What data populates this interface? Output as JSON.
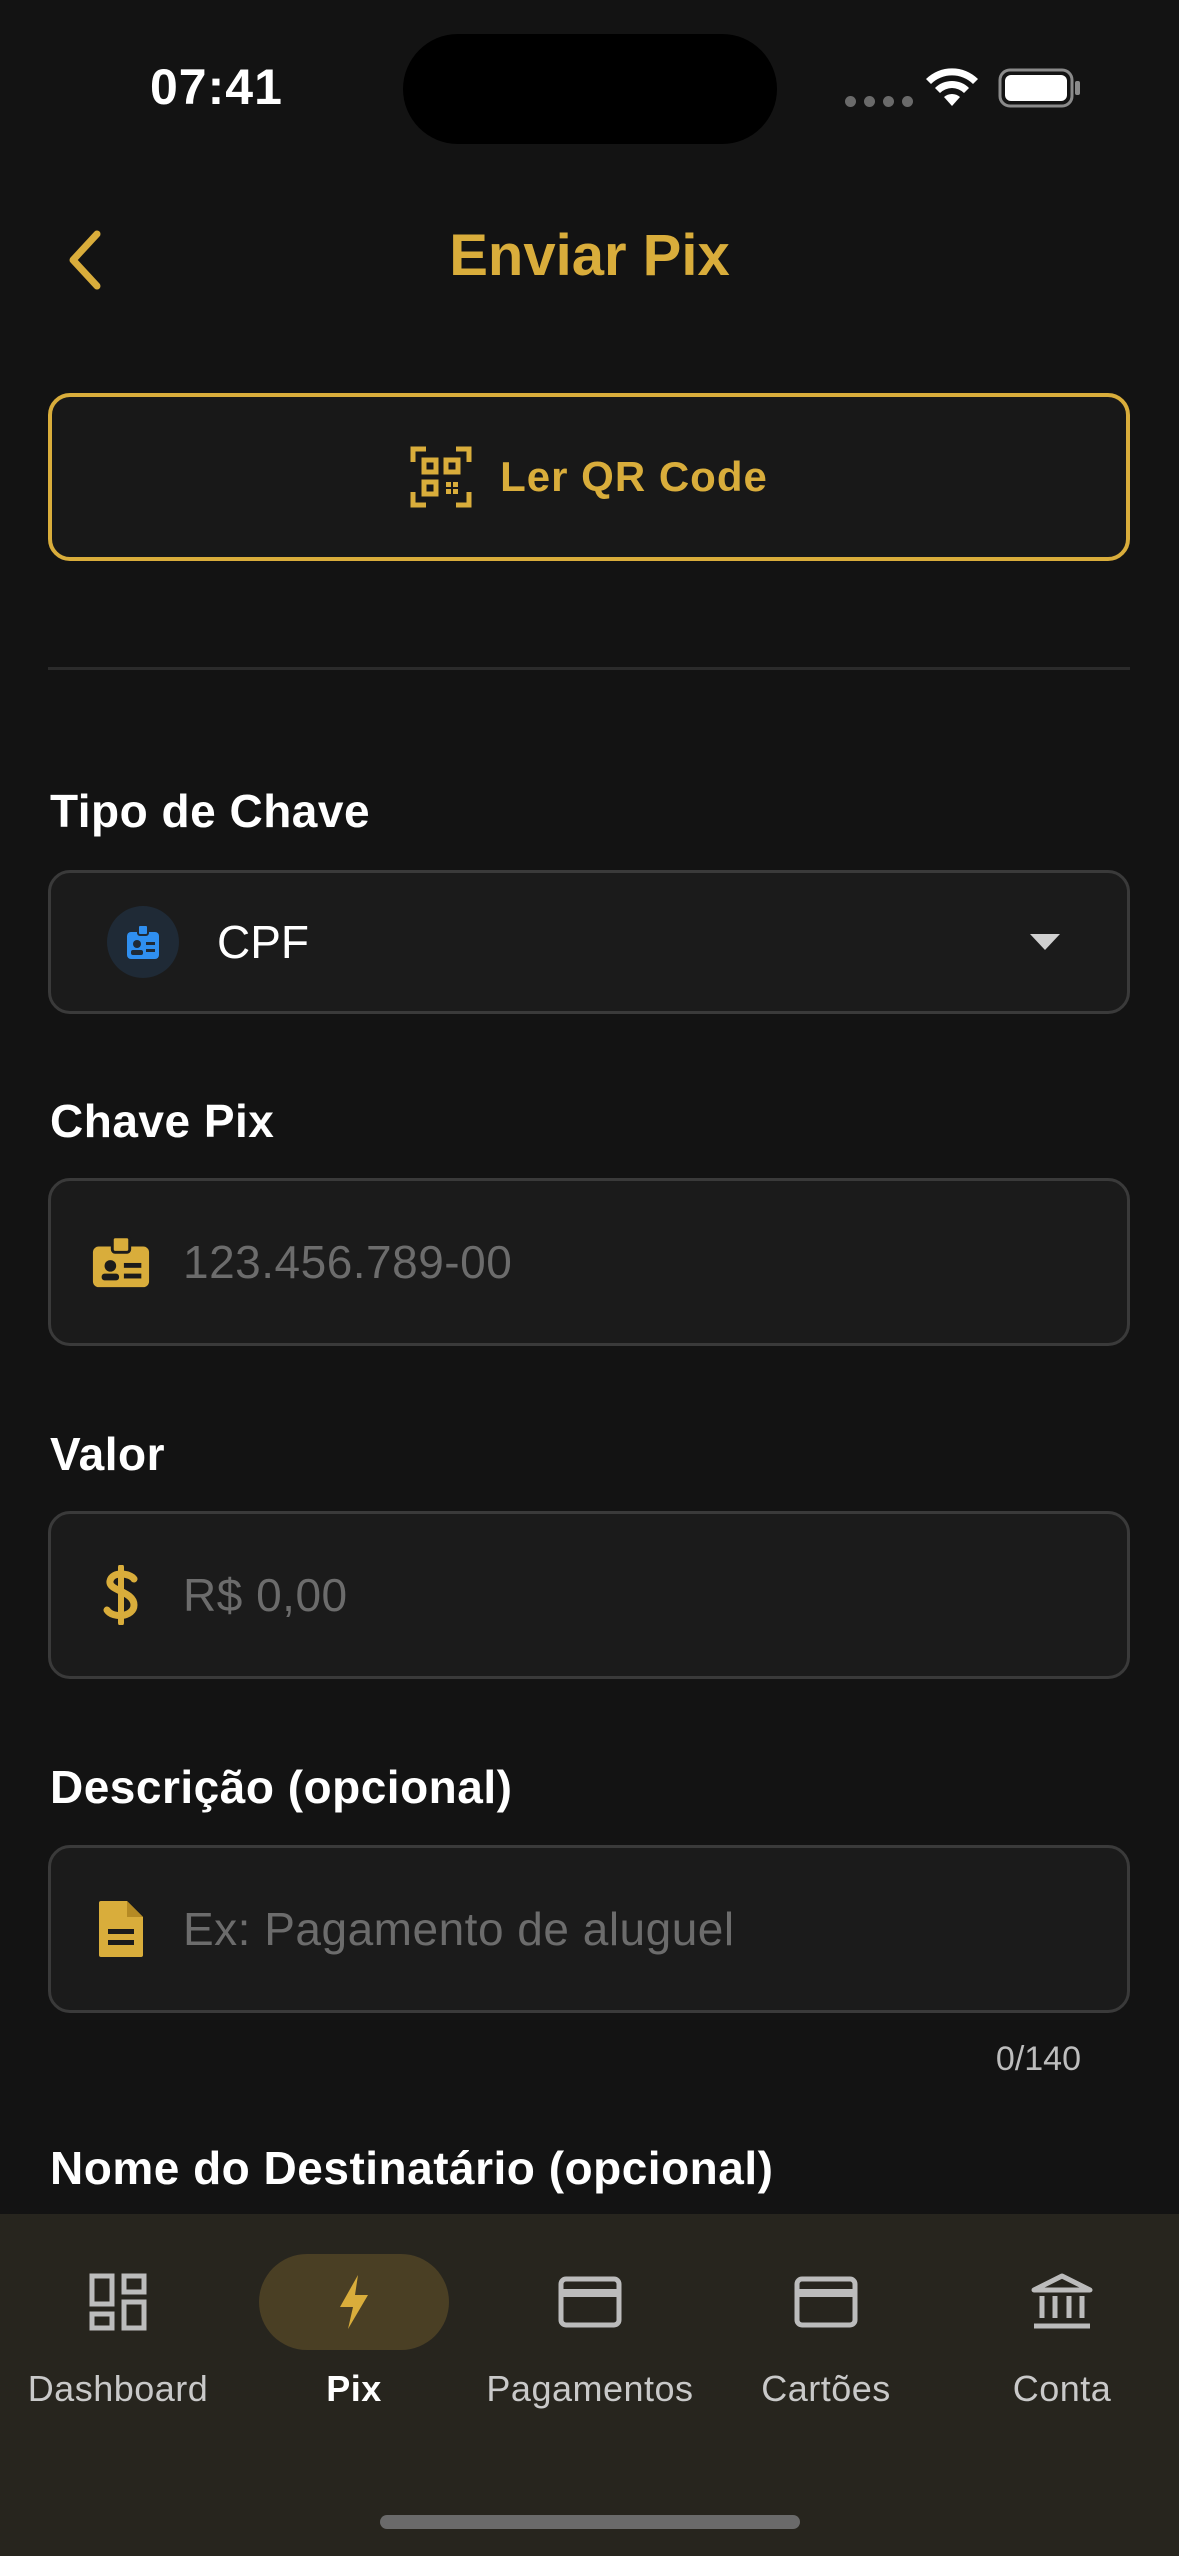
{
  "status_bar": {
    "time": "07:41"
  },
  "header": {
    "title": "Enviar Pix"
  },
  "qr_button": {
    "label": "Ler QR Code"
  },
  "fields": {
    "key_type": {
      "label": "Tipo de Chave",
      "value": "CPF"
    },
    "pix_key": {
      "label": "Chave Pix",
      "placeholder": "123.456.789-00"
    },
    "amount": {
      "label": "Valor",
      "placeholder": "R$ 0,00"
    },
    "description": {
      "label": "Descrição (opcional)",
      "placeholder": "Ex: Pagamento de aluguel",
      "counter": "0/140"
    },
    "recipient_name": {
      "label": "Nome do Destinatário (opcional)"
    }
  },
  "bottom_nav": {
    "items": [
      {
        "label": "Dashboard",
        "icon": "dashboard-icon"
      },
      {
        "label": "Pix",
        "icon": "bolt-icon",
        "active": true
      },
      {
        "label": "Pagamentos",
        "icon": "card-icon"
      },
      {
        "label": "Cartões",
        "icon": "card-icon"
      },
      {
        "label": "Conta",
        "icon": "bank-icon"
      }
    ]
  },
  "colors": {
    "accent": "#d9ad3b",
    "background": "#131313",
    "nav_background": "#27251e",
    "badge_blue": "#2f8ff0"
  }
}
